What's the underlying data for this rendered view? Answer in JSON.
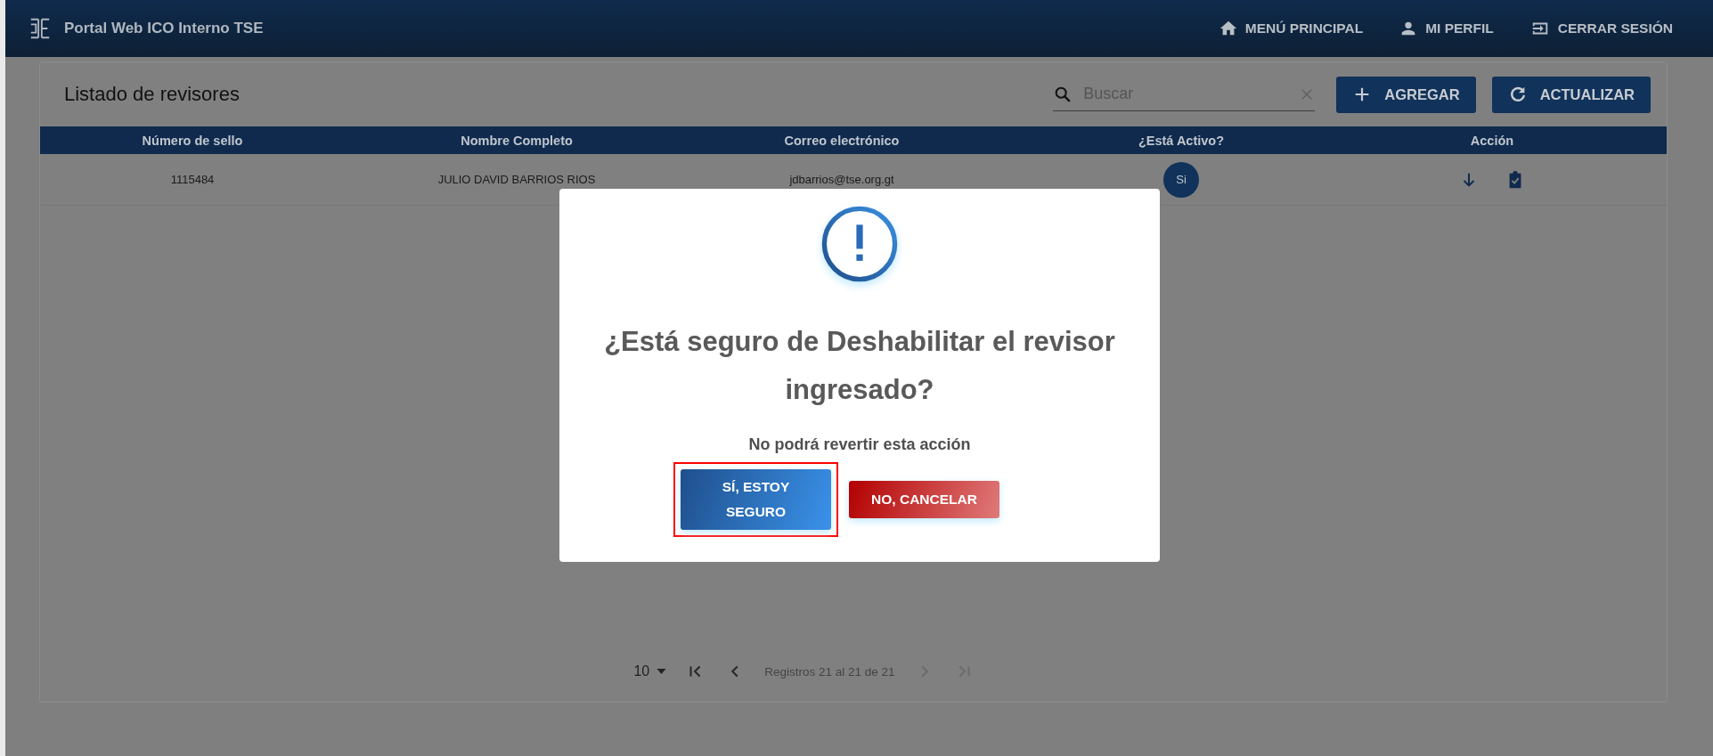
{
  "header": {
    "title": "Portal Web ICO Interno TSE",
    "nav": [
      {
        "kind": "home",
        "label": "MENÚ PRINCIPAL"
      },
      {
        "kind": "person",
        "label": "MI PERFIL"
      },
      {
        "kind": "logout",
        "label": "CERRAR SESIÓN"
      }
    ]
  },
  "card": {
    "title": "Listado de revisores",
    "search": {
      "placeholder": "Buscar"
    },
    "buttons": [
      {
        "kind": "add",
        "label": "AGREGAR"
      },
      {
        "kind": "refresh",
        "label": "ACTUALIZAR"
      }
    ]
  },
  "table": {
    "columns": [
      "Número de sello",
      "Nombre Completo",
      "Correo electrónico",
      "¿Está Activo?",
      "Acción"
    ],
    "rows": [
      {
        "seal": "1115484",
        "name": "JULIO DAVID BARRIOS RIOS",
        "email": "jdbarrios@tse.org.gt",
        "active": "Si"
      }
    ]
  },
  "pagination": {
    "page_size": "10",
    "range": "Registros 21 al 21 de 21",
    "buttons": [
      {
        "kind": "first",
        "disabled": false
      },
      {
        "kind": "prev",
        "disabled": false
      },
      {
        "kind": "next",
        "disabled": true
      },
      {
        "kind": "last",
        "disabled": true
      }
    ]
  },
  "dialog": {
    "title": "¿Está seguro de Deshabilitar el revisor ingresado?",
    "message": "No podrá revertir esta acción",
    "confirm": {
      "label": "SÍ, ESTOY SEGURO",
      "highlighted": true
    },
    "cancel": {
      "label": "NO, CANCELAR",
      "highlighted": false
    }
  }
}
